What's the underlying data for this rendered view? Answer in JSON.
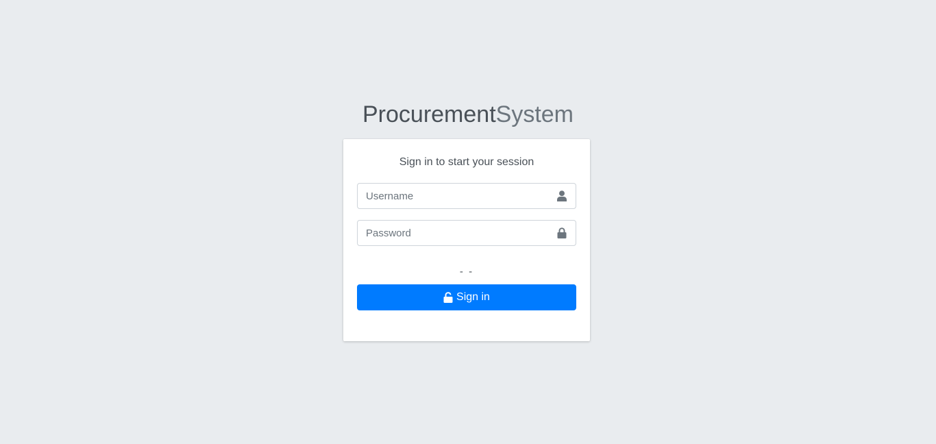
{
  "logo": {
    "bold": "Procurement",
    "light": "System"
  },
  "login": {
    "message": "Sign in to start your session",
    "username": {
      "placeholder": "Username",
      "value": "",
      "icon": "user-icon"
    },
    "password": {
      "placeholder": "Password",
      "value": "",
      "icon": "lock-icon"
    },
    "captcha_text": "- -",
    "signin_label": "Sign in",
    "signin_icon": "unlock-icon"
  },
  "colors": {
    "background": "#e9ecef",
    "card": "#ffffff",
    "primary": "#007bff",
    "icon": "#6c757d"
  }
}
